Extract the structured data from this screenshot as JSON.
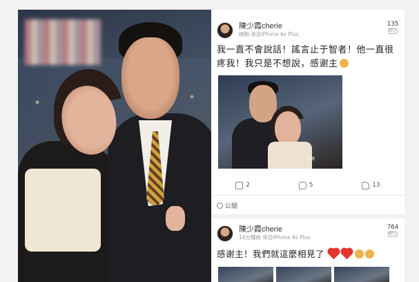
{
  "post1": {
    "username": "陳少霞cherie",
    "time": "剛剛",
    "source": "來自iPhone 6s Plus",
    "follow_count": "135",
    "follow_label": "關注",
    "text": "我一直不會說話！謠言止于智者！他一直很疼我！我只是不想說，感谢主",
    "photo_watermark": "微博",
    "reposts": "2",
    "comments": "5",
    "likes": "13"
  },
  "visibility": "公開",
  "post2": {
    "username": "陳少霞cherie",
    "time": "14分鐘前",
    "source": "來自iPhone 6s Plus",
    "follow_count": "764",
    "follow_label": "關注",
    "text": "感谢主！我們就這麼相見了"
  },
  "icons": {
    "repost": "repost-icon",
    "comment": "comment-icon",
    "like": "like-icon",
    "globe": "globe-icon"
  },
  "colors": {
    "heart": "#e3342f",
    "emoji": "#f0b34a"
  }
}
